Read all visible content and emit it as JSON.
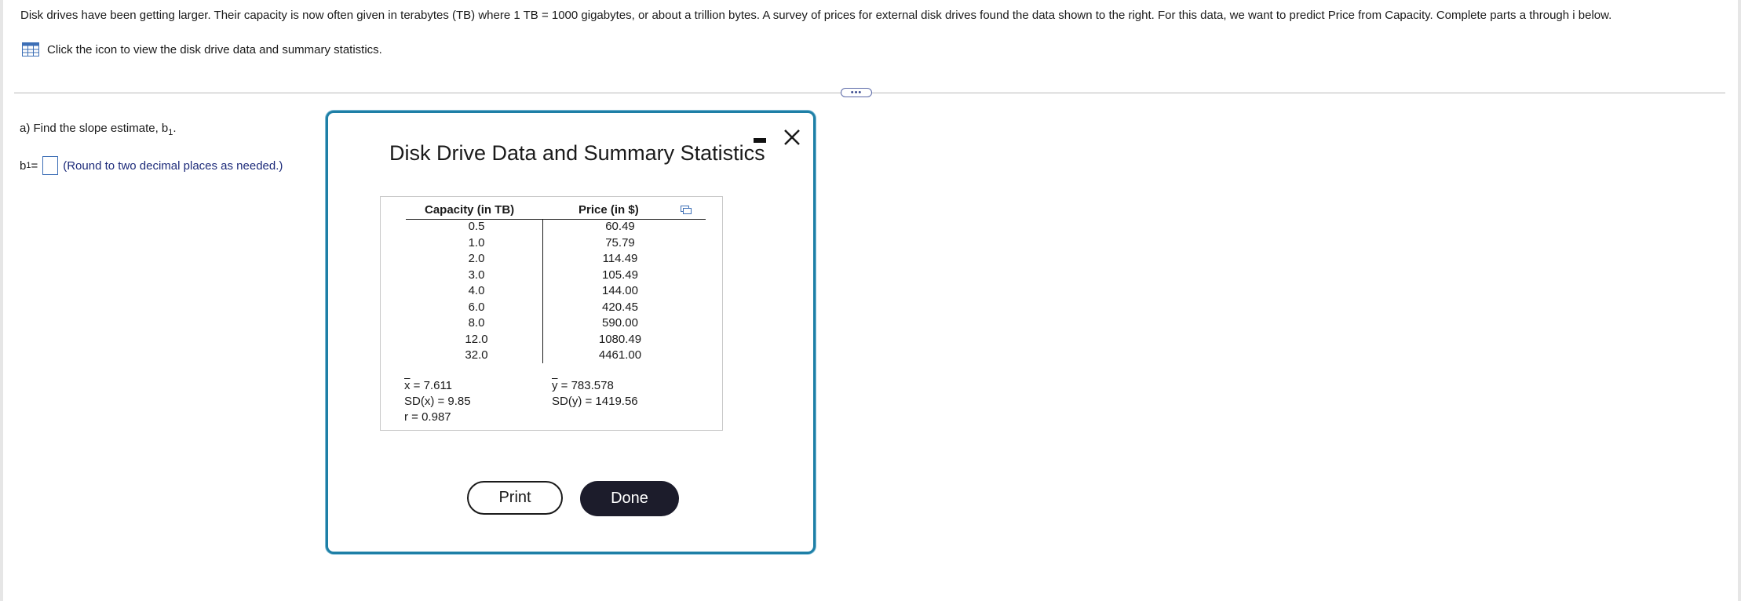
{
  "problem": {
    "text": "Disk drives have been getting larger. Their capacity is now often given in terabytes (TB) where 1 TB = 1000 gigabytes, or about a trillion bytes. A survey of prices for external disk drives found the data shown to the right. For this data, we want to predict Price from Capacity. Complete parts a through i below.",
    "data_link_label": "Click the icon to view the disk drive data and summary statistics."
  },
  "more_button": "•••",
  "part_a": {
    "prompt_prefix": "a) Find the slope estimate, b",
    "prompt_sub": "1",
    "prompt_suffix": ".",
    "answer_label_prefix": "b",
    "answer_label_sub": "1",
    "answer_label_eq": " =",
    "answer_value": "",
    "hint": "(Round to two decimal places as needed.)"
  },
  "dialog": {
    "title": "Disk Drive Data and Summary Statistics",
    "table": {
      "headers": [
        "Capacity (in TB)",
        "Price (in $)"
      ],
      "capacity": [
        "0.5",
        "1.0",
        "2.0",
        "3.0",
        "4.0",
        "6.0",
        "8.0",
        "12.0",
        "32.0"
      ],
      "price": [
        "60.49",
        "75.79",
        "114.49",
        "105.49",
        "144.00",
        "420.45",
        "590.00",
        "1080.49",
        "4461.00"
      ]
    },
    "stats": {
      "xbar_sym": "x",
      "xbar_val": " = 7.611",
      "sdx": "SD(x) = 9.85",
      "r": "r = 0.987",
      "ybar_sym": "y",
      "ybar_val": " = 783.578",
      "sdy": "SD(y) = 1419.56"
    },
    "print_label": "Print",
    "done_label": "Done"
  },
  "colors": {
    "accent": "#1e7fa6",
    "done_bg": "#1c1c2b",
    "link_blue": "#1d2b7a"
  }
}
